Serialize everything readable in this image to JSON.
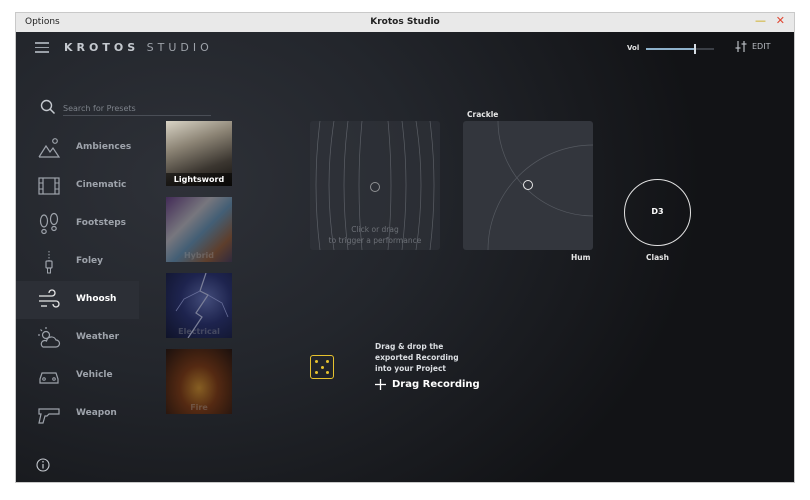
{
  "window": {
    "menu_label": "Options",
    "title": "Krotos Studio"
  },
  "header": {
    "brand_bold": "KROTOS",
    "brand_light": "STUDIO",
    "vol_label": "Vol",
    "volume_level": 0.72,
    "edit_label": "EDIT"
  },
  "search": {
    "placeholder": "Search for Presets"
  },
  "categories": [
    {
      "label": "Ambiences",
      "icon": "mountain-icon"
    },
    {
      "label": "Cinematic",
      "icon": "film-icon"
    },
    {
      "label": "Footsteps",
      "icon": "footprints-icon"
    },
    {
      "label": "Foley",
      "icon": "zipper-icon"
    },
    {
      "label": "Whoosh",
      "icon": "wind-icon",
      "active": true
    },
    {
      "label": "Weather",
      "icon": "cloud-sun-icon"
    },
    {
      "label": "Vehicle",
      "icon": "car-icon"
    },
    {
      "label": "Weapon",
      "icon": "gun-icon"
    }
  ],
  "presets": [
    {
      "label": "Lightsword",
      "active": true
    },
    {
      "label": "Hybrid"
    },
    {
      "label": "Electrical"
    },
    {
      "label": "Fire"
    }
  ],
  "performance_pad": {
    "hint_line1": "Click or drag",
    "hint_line2": "to trigger a performance"
  },
  "xy_pad": {
    "title": "Crackle",
    "axis_label": "Hum"
  },
  "knob": {
    "value": "D3",
    "label": "Clash"
  },
  "drag": {
    "line1": "Drag & drop the",
    "line2": "exported Recording",
    "line3": "into your Project",
    "button_label": "Drag Recording"
  },
  "colors": {
    "accent_yellow": "#e6c22e",
    "volume_fill": "#8fb2cc",
    "background": "#1b1d22"
  }
}
